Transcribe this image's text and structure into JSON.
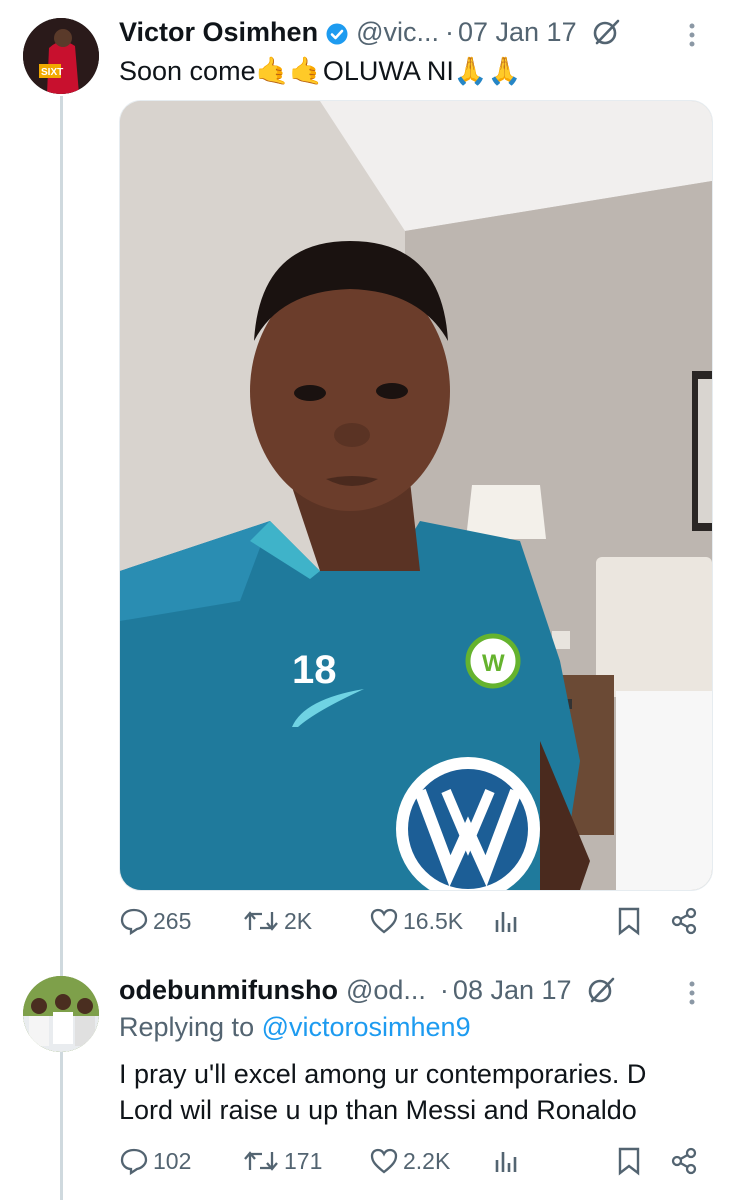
{
  "tweet": {
    "name": "Victor Osimhen",
    "handle": "@vic...",
    "separator": "·",
    "date": "07 Jan 17",
    "text": "Soon come🤙🤙OLUWA NI🙏🙏",
    "jersey_number": "18",
    "replies": "265",
    "reposts": "2K",
    "likes": "16.5K"
  },
  "reply": {
    "name": "odebunmifunsho",
    "handle": "@od...",
    "separator": "·",
    "date": "08 Jan 17",
    "replying_prefix": "Replying to ",
    "replying_handle": "@victorosimhen9",
    "text": "I pray u'll excel among ur contemporaries. D Lord wil raise u up than Messi and Ronaldo",
    "replies": "102",
    "reposts": "171",
    "likes": "2.2K"
  },
  "colors": {
    "accent": "#1d9bf0",
    "secondary_text": "#536471",
    "jersey": "#1f7a9c"
  },
  "icons": [
    "verified-badge-icon",
    "grok-icon",
    "more-icon",
    "reply-icon",
    "repost-icon",
    "like-icon",
    "views-icon",
    "bookmark-icon",
    "share-icon"
  ]
}
